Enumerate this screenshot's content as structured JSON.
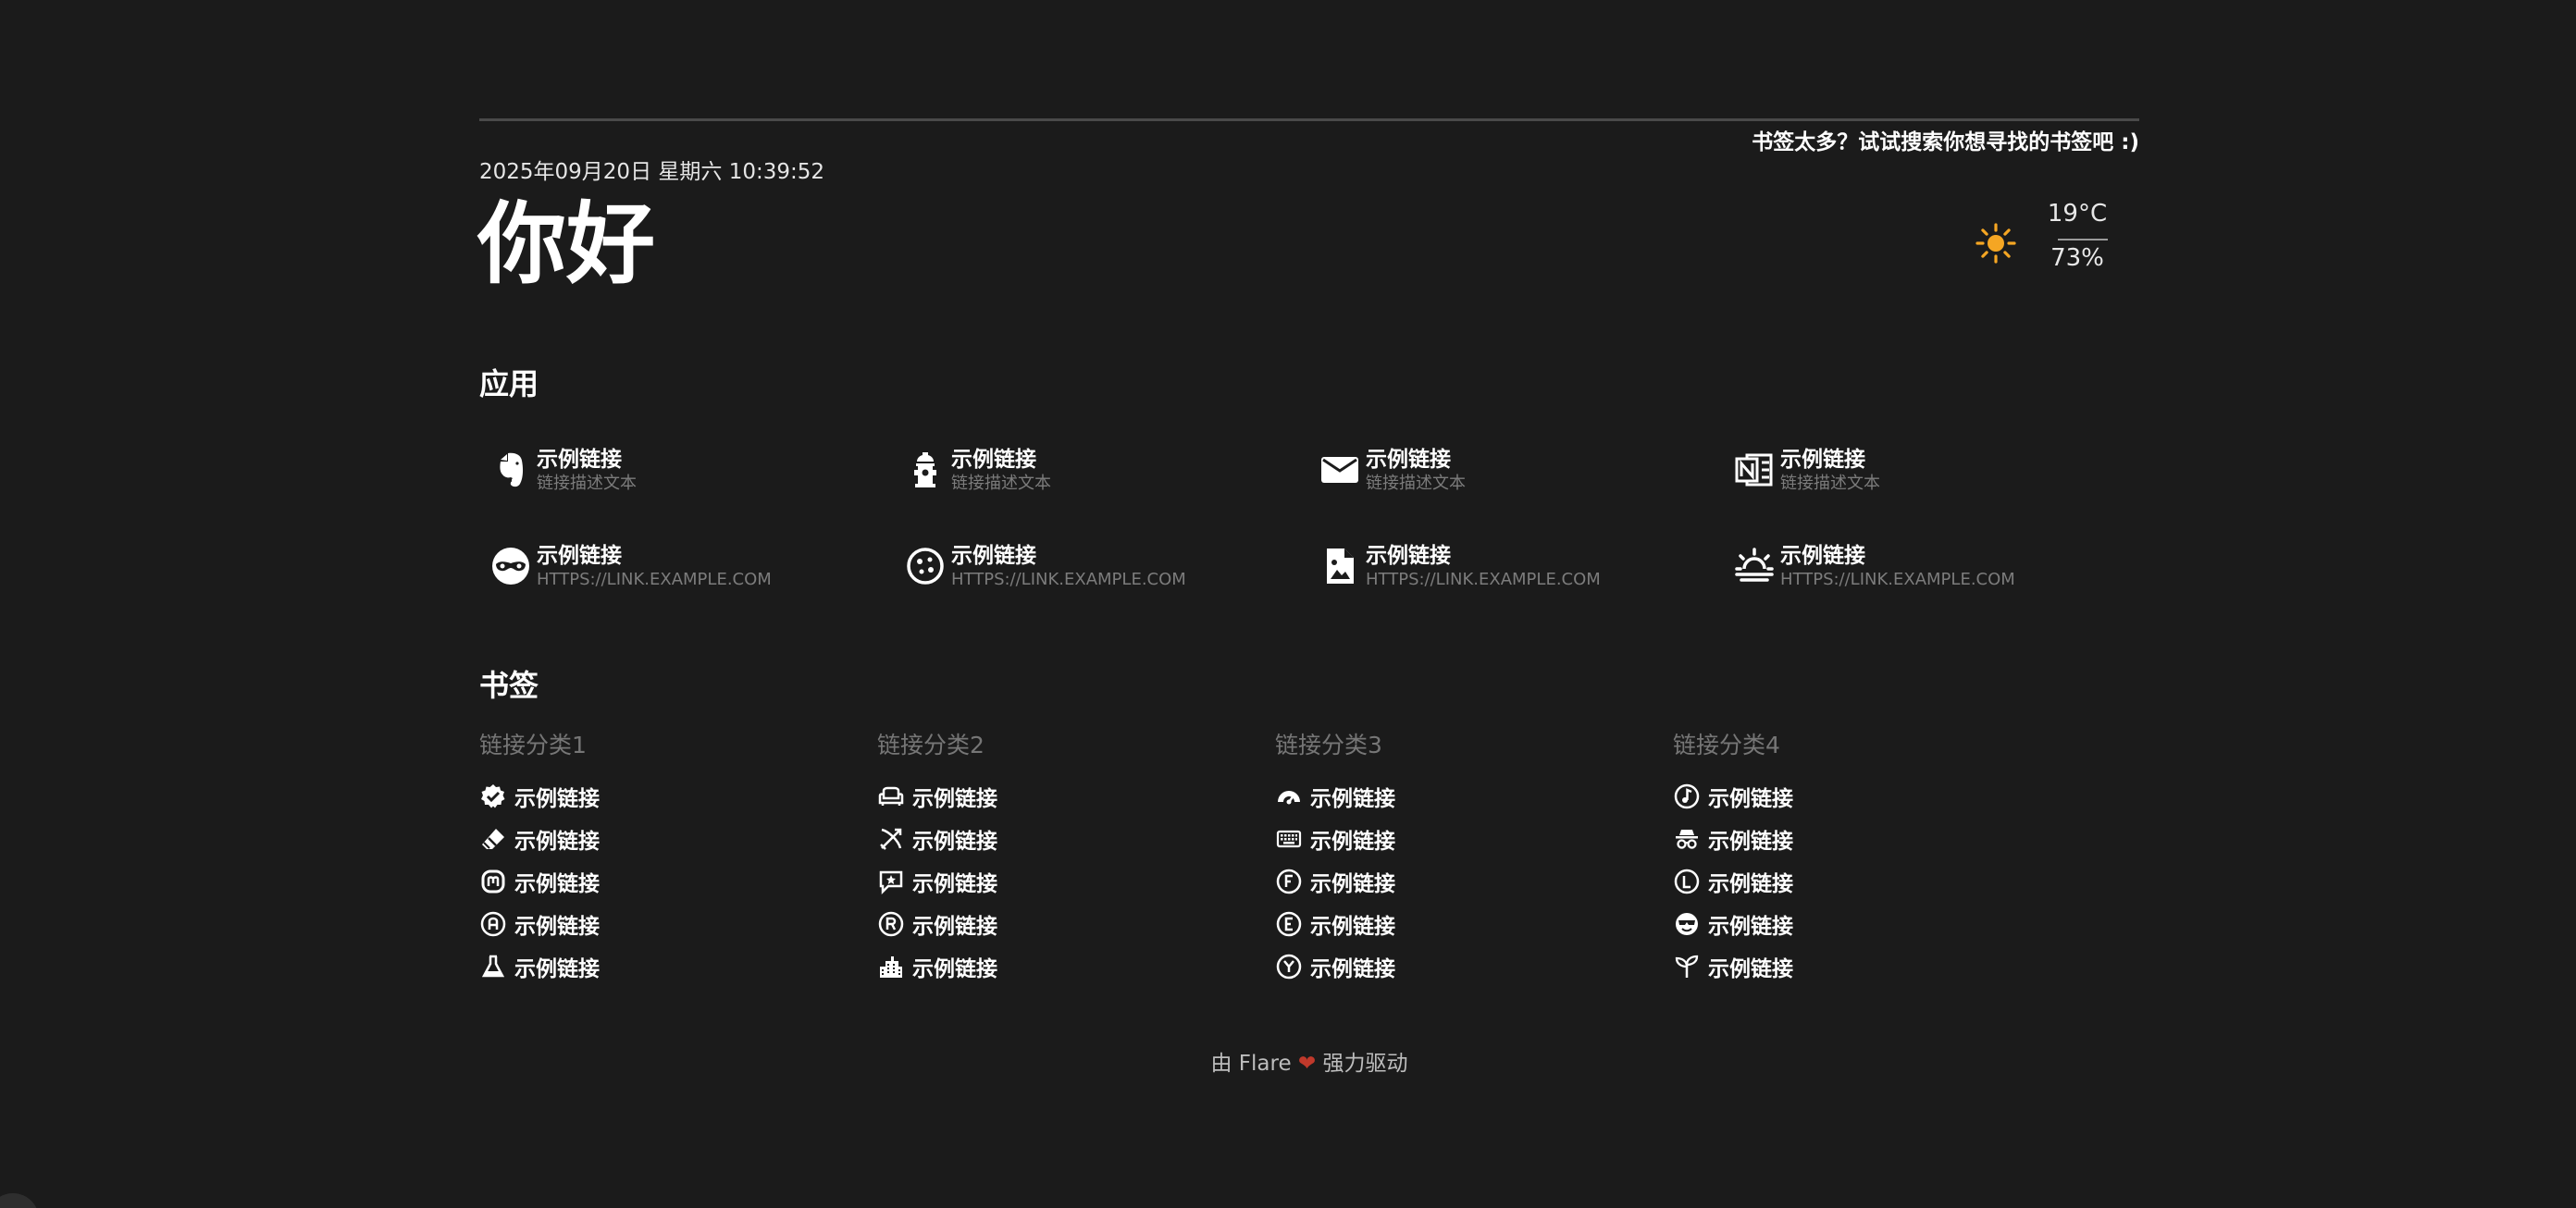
{
  "header": {
    "search_hint": "书签太多？试试搜索你想寻找的书签吧 :)",
    "datetime": "2025年09月20日 星期六 10:39:52",
    "greeting": "你好"
  },
  "weather": {
    "icon": "sun-icon",
    "temperature": "19°C",
    "humidity": "73%",
    "accent_color": "#f5a623"
  },
  "apps": {
    "title": "应用",
    "items": [
      {
        "title": "示例链接",
        "desc": "链接描述文本",
        "icon": "evernote-icon"
      },
      {
        "title": "示例链接",
        "desc": "链接描述文本",
        "icon": "fire-hydrant-icon"
      },
      {
        "title": "示例链接",
        "desc": "链接描述文本",
        "icon": "email-icon"
      },
      {
        "title": "示例链接",
        "desc": "链接描述文本",
        "icon": "onenote-icon"
      },
      {
        "title": "示例链接",
        "desc": "HTTPS://LINK.EXAMPLE.COM",
        "icon": "incognito-mask-icon"
      },
      {
        "title": "示例链接",
        "desc": "HTTPS://LINK.EXAMPLE.COM",
        "icon": "cookie-icon"
      },
      {
        "title": "示例链接",
        "desc": "HTTPS://LINK.EXAMPLE.COM",
        "icon": "file-image-icon"
      },
      {
        "title": "示例链接",
        "desc": "HTTPS://LINK.EXAMPLE.COM",
        "icon": "sunset-icon"
      }
    ]
  },
  "bookmarks": {
    "title": "书签",
    "categories": [
      {
        "name": "链接分类1",
        "links": [
          {
            "label": "示例链接",
            "icon": "check-decagram-icon"
          },
          {
            "label": "示例链接",
            "icon": "eraser-icon"
          },
          {
            "label": "示例链接",
            "icon": "mastodon-icon"
          },
          {
            "label": "示例链接",
            "icon": "alpha-a-circle-icon"
          },
          {
            "label": "示例链接",
            "icon": "flask-icon"
          }
        ]
      },
      {
        "name": "链接分类2",
        "links": [
          {
            "label": "示例链接",
            "icon": "sofa-icon"
          },
          {
            "label": "示例链接",
            "icon": "bow-arrow-icon"
          },
          {
            "label": "示例链接",
            "icon": "comment-star-icon"
          },
          {
            "label": "示例链接",
            "icon": "alpha-r-circle-icon"
          },
          {
            "label": "示例链接",
            "icon": "city-icon"
          }
        ]
      },
      {
        "name": "链接分类3",
        "links": [
          {
            "label": "示例链接",
            "icon": "gauge-icon"
          },
          {
            "label": "示例链接",
            "icon": "keyboard-icon"
          },
          {
            "label": "示例链接",
            "icon": "alpha-f-circle-icon"
          },
          {
            "label": "示例链接",
            "icon": "alpha-e-circle-icon"
          },
          {
            "label": "示例链接",
            "icon": "alpha-y-circle-icon"
          }
        ]
      },
      {
        "name": "链接分类4",
        "links": [
          {
            "label": "示例链接",
            "icon": "music-note-circle-icon"
          },
          {
            "label": "示例链接",
            "icon": "incognito-icon"
          },
          {
            "label": "示例链接",
            "icon": "alpha-l-circle-icon"
          },
          {
            "label": "示例链接",
            "icon": "emoticon-cool-icon"
          },
          {
            "label": "示例链接",
            "icon": "sprout-icon"
          }
        ]
      }
    ]
  },
  "footer": {
    "prefix": "由 Flare",
    "heart": "❤",
    "suffix": "强力驱动"
  }
}
